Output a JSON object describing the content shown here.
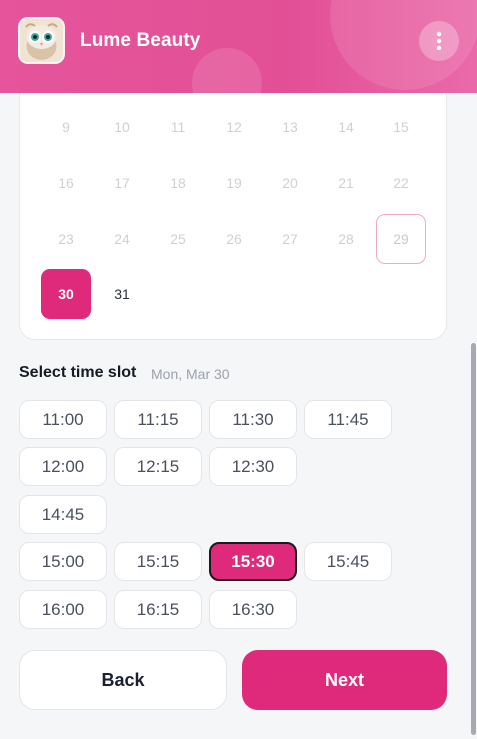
{
  "header": {
    "brand": "Lume Beauty",
    "avatar_icon": "owl-mascot-icon",
    "menu_icon": "more-vertical-icon"
  },
  "calendar": {
    "rows": [
      [
        {
          "day": "9",
          "state": "disabled"
        },
        {
          "day": "10",
          "state": "disabled"
        },
        {
          "day": "11",
          "state": "disabled"
        },
        {
          "day": "12",
          "state": "disabled"
        },
        {
          "day": "13",
          "state": "disabled"
        },
        {
          "day": "14",
          "state": "disabled"
        },
        {
          "day": "15",
          "state": "disabled"
        }
      ],
      [
        {
          "day": "16",
          "state": "disabled"
        },
        {
          "day": "17",
          "state": "disabled"
        },
        {
          "day": "18",
          "state": "disabled"
        },
        {
          "day": "19",
          "state": "disabled"
        },
        {
          "day": "20",
          "state": "disabled"
        },
        {
          "day": "21",
          "state": "disabled"
        },
        {
          "day": "22",
          "state": "disabled"
        }
      ],
      [
        {
          "day": "23",
          "state": "disabled"
        },
        {
          "day": "24",
          "state": "disabled"
        },
        {
          "day": "25",
          "state": "disabled"
        },
        {
          "day": "26",
          "state": "disabled"
        },
        {
          "day": "27",
          "state": "disabled"
        },
        {
          "day": "28",
          "state": "disabled"
        },
        {
          "day": "29",
          "state": "today"
        }
      ],
      [
        {
          "day": "30",
          "state": "selected"
        },
        {
          "day": "31",
          "state": "available"
        }
      ]
    ]
  },
  "time_slots": {
    "title": "Select time slot",
    "date_label": "Mon, Mar 30",
    "rows": [
      [
        {
          "label": "11:00"
        },
        {
          "label": "11:15"
        },
        {
          "label": "11:30"
        },
        {
          "label": "11:45"
        }
      ],
      [
        {
          "label": "12:00"
        },
        {
          "label": "12:15"
        },
        {
          "label": "12:30"
        }
      ],
      [
        {
          "label": "14:45"
        }
      ],
      [
        {
          "label": "15:00"
        },
        {
          "label": "15:15"
        },
        {
          "label": "15:30",
          "selected": true
        },
        {
          "label": "15:45"
        }
      ],
      [
        {
          "label": "16:00"
        },
        {
          "label": "16:15"
        },
        {
          "label": "16:30"
        }
      ]
    ]
  },
  "actions": {
    "back_label": "Back",
    "next_label": "Next"
  },
  "colors": {
    "accent": "#df2a7c",
    "header_gradient_start": "#e5559b",
    "today_outline": "#f0a9c9"
  }
}
